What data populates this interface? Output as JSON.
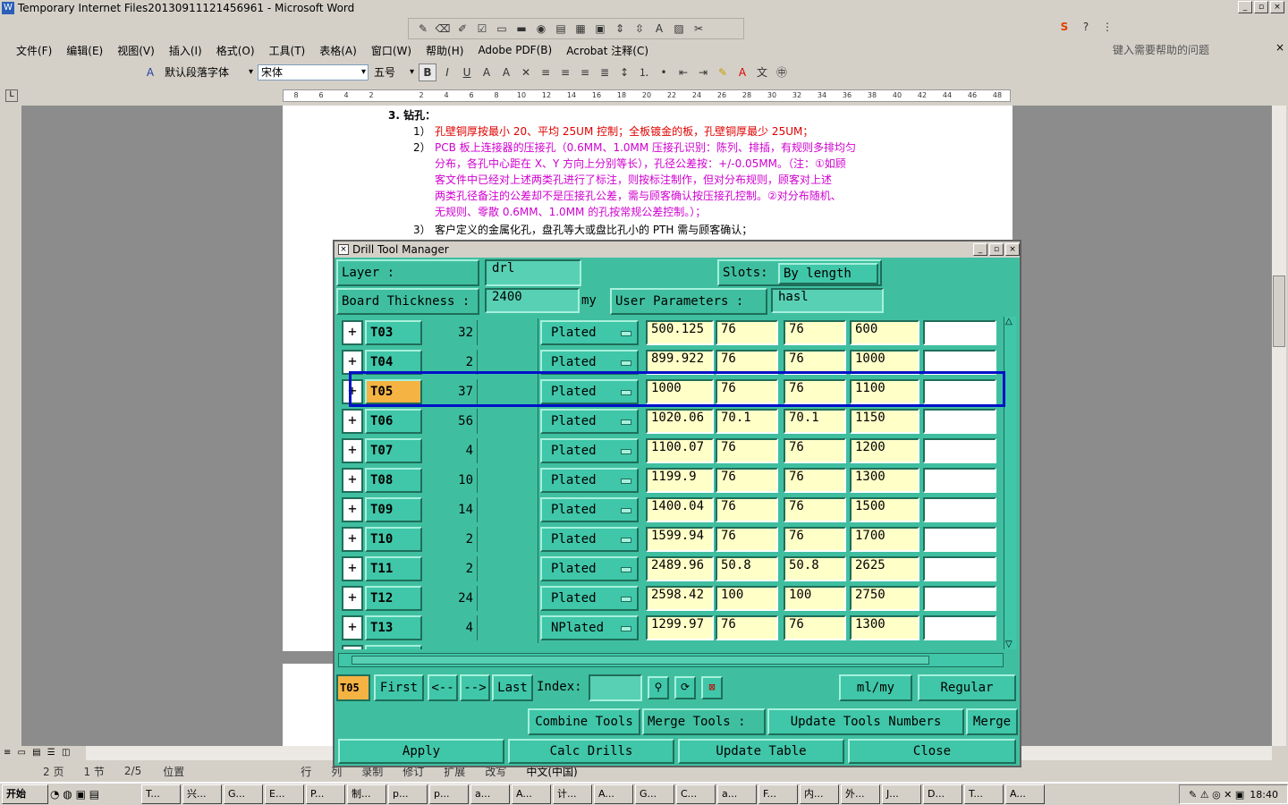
{
  "window": {
    "title": "Temporary Internet Files20130911121456961 - Microsoft Word",
    "icon": "W",
    "min": "_",
    "max": "▫",
    "close": "×"
  },
  "menu": [
    "文件(F)",
    "编辑(E)",
    "视图(V)",
    "插入(I)",
    "格式(O)",
    "工具(T)",
    "表格(A)",
    "窗口(W)",
    "帮助(H)",
    "Adobe PDF(B)",
    "Acrobat 注释(C)"
  ],
  "format": {
    "style": "默认段落字体",
    "font": "宋体",
    "size": "五号"
  },
  "help_placeholder": "键入需要帮助的问题",
  "ruler": [
    "8",
    "6",
    "4",
    "2",
    "",
    "2",
    "4",
    "6",
    "8",
    "10",
    "12",
    "14",
    "16",
    "18",
    "20",
    "22",
    "24",
    "26",
    "28",
    "30",
    "32",
    "34",
    "36",
    "38",
    "40",
    "42",
    "44",
    "46",
    "48"
  ],
  "doc": {
    "heading": "3.  钻孔：",
    "l1_num": "1）",
    "l1": "孔壁铜厚按最小 20、平均 25UM 控制；全板镀金的板，孔壁铜厚最少 25UM；",
    "l2_num": "2）",
    "l2a": "PCB 板上连接器的压接孔（0.6MM、1.0MM 压接孔识别：陈列、排插，有规则多排均匀",
    "l2b": "分布，各孔中心距在 X、Y 方向上分别等长），孔径公差按：+/-0.05MM。（注：①如顾",
    "l2c": "客文件中已经对上述两类孔进行了标注，则按标注制作，但对分布规则，顾客对上述",
    "l2d": "两类孔径备注的公差却不是压接孔公差，需与顾客确认按压接孔控制。②对分布随机、",
    "l2e": "无规则、零散 0.6MM、1.0MM 的孔按常规公差控制。）；",
    "l3_num": "3）",
    "l3": "客户定义的金属化孔，盘孔等大或盘比孔小的 PTH 需与顾客确认；"
  },
  "status": {
    "page": "2 页",
    "section": "1 节",
    "pages": "2/5",
    "pos": "位置",
    "rec": "行",
    "col": "列",
    "mode1": "录制",
    "mode2": "修订",
    "mode3": "扩展",
    "mode4": "改写",
    "lang": "中文(中国)"
  },
  "taskbar": {
    "start": "开始",
    "items": [
      "T...",
      "兴...",
      "G...",
      "E...",
      "P...",
      "制...",
      "p...",
      "p...",
      "a...",
      "A...",
      "计...",
      "A...",
      "G...",
      "C...",
      "a...",
      "F...",
      "内...",
      "外...",
      "J...",
      "D...",
      "T...",
      "A..."
    ],
    "clock": "18:40"
  },
  "dialog": {
    "title": "Drill Tool Manager",
    "layer_label": "Layer         :",
    "layer": "drl",
    "slots_label": "Slots:",
    "slots": "By length",
    "thick_label": "Board Thickness :",
    "thick": "2400",
    "thick_unit": "my",
    "userparam_label": "User Parameters :",
    "userparam": "hasl",
    "rows": [
      {
        "tool": "T03",
        "count": "32",
        "type": "Plated",
        "d1": "500.125",
        "d2": "76",
        "d3": "76",
        "d4": "600"
      },
      {
        "tool": "T04",
        "count": "2",
        "type": "Plated",
        "d1": "899.922",
        "d2": "76",
        "d3": "76",
        "d4": "1000"
      },
      {
        "tool": "T05",
        "count": "37",
        "type": "Plated",
        "d1": "1000",
        "d2": "76",
        "d3": "76",
        "d4": "1100"
      },
      {
        "tool": "T06",
        "count": "56",
        "type": "Plated",
        "d1": "1020.06",
        "d2": "70.1",
        "d3": "70.1",
        "d4": "1150"
      },
      {
        "tool": "T07",
        "count": "4",
        "type": "Plated",
        "d1": "1100.07",
        "d2": "76",
        "d3": "76",
        "d4": "1200"
      },
      {
        "tool": "T08",
        "count": "10",
        "type": "Plated",
        "d1": "1199.9",
        "d2": "76",
        "d3": "76",
        "d4": "1300"
      },
      {
        "tool": "T09",
        "count": "14",
        "type": "Plated",
        "d1": "1400.04",
        "d2": "76",
        "d3": "76",
        "d4": "1500"
      },
      {
        "tool": "T10",
        "count": "2",
        "type": "Plated",
        "d1": "1599.94",
        "d2": "76",
        "d3": "76",
        "d4": "1700"
      },
      {
        "tool": "T11",
        "count": "2",
        "type": "Plated",
        "d1": "2489.96",
        "d2": "50.8",
        "d3": "50.8",
        "d4": "2625"
      },
      {
        "tool": "T12",
        "count": "24",
        "type": "Plated",
        "d1": "2598.42",
        "d2": "100",
        "d3": "100",
        "d4": "2750"
      },
      {
        "tool": "T13",
        "count": "4",
        "type": "NPlated",
        "d1": "1299.97",
        "d2": "76",
        "d3": "76",
        "d4": "1300"
      }
    ],
    "current": "T05",
    "first": "First",
    "prev": "<--",
    "next": "-->",
    "last": "Last",
    "index_label": "Index:",
    "units": "ml/my",
    "mode": "Regular",
    "combine": "Combine Tools",
    "merge_tools": "Merge Tools  :",
    "update_nums": "Update Tools Numbers",
    "merge": "Merge",
    "apply": "Apply",
    "calc": "Calc Drills",
    "update_table": "Update Table",
    "close": "Close"
  }
}
